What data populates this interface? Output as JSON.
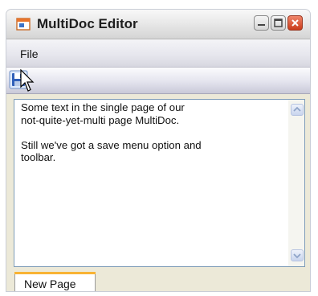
{
  "window": {
    "title": "MultiDoc Editor"
  },
  "menu": {
    "file_label": "File"
  },
  "editor": {
    "text": "Some text in the single page of our\nnot-quite-yet-multi page MultiDoc.\n\nStill we've got a save menu option and\ntoolbar."
  },
  "tabs": [
    {
      "label": "New Page",
      "selected": true
    }
  ],
  "icons": {
    "app": "app-window-icon",
    "save": "floppy-disk-icon",
    "cursor": "mouse-pointer-icon"
  },
  "colors": {
    "tab_accent": "#f8b334",
    "close_button": "#c93b1a"
  }
}
